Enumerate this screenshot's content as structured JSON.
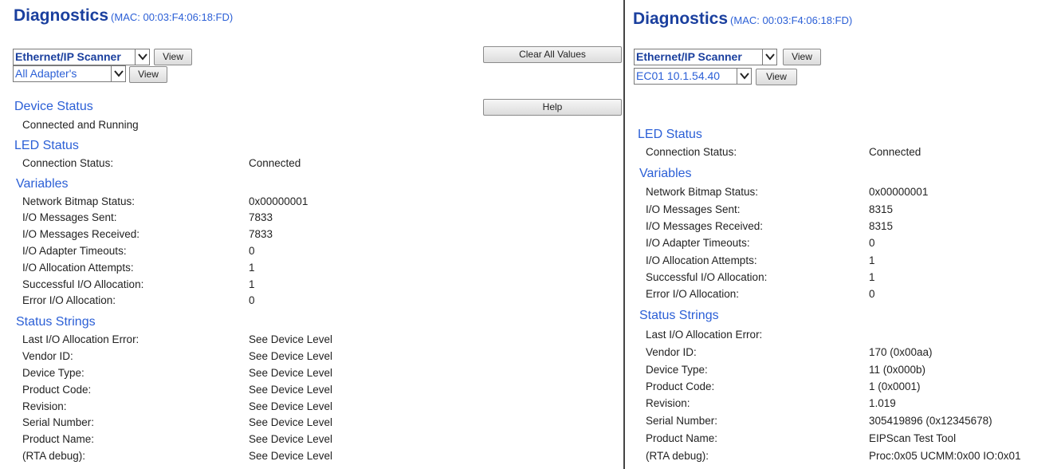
{
  "left": {
    "title": "Diagnostics",
    "mac": "(MAC: 00:03:F4:06:18:FD)",
    "scanner_select": "Ethernet/IP Scanner",
    "scanner_view_btn": "View",
    "adapter_select": "All Adapter's",
    "adapter_view_btn": "View",
    "clear_btn": "Clear All Values",
    "help_btn": "Help",
    "device_status_heading": "Device Status",
    "device_status_text": "Connected and Running",
    "led_heading": "LED Status",
    "led_rows": [
      {
        "label": "Connection Status:",
        "value": "Connected"
      }
    ],
    "variables_heading": "Variables",
    "variable_rows": [
      {
        "label": "Network Bitmap Status:",
        "value": "0x00000001"
      },
      {
        "label": "I/O Messages Sent:",
        "value": "7833"
      },
      {
        "label": "I/O Messages Received:",
        "value": "7833"
      },
      {
        "label": "I/O Adapter Timeouts:",
        "value": "0"
      },
      {
        "label": "I/O Allocation Attempts:",
        "value": "1"
      },
      {
        "label": "Successful I/O Allocation:",
        "value": "1"
      },
      {
        "label": "Error I/O Allocation:",
        "value": "0"
      }
    ],
    "status_heading": "Status Strings",
    "status_rows": [
      {
        "label": "Last I/O Allocation Error:",
        "value": "See Device Level"
      },
      {
        "label": "Vendor ID:",
        "value": "See Device Level"
      },
      {
        "label": "Device Type:",
        "value": "See Device Level"
      },
      {
        "label": "Product Code:",
        "value": "See Device Level"
      },
      {
        "label": "Revision:",
        "value": "See Device Level"
      },
      {
        "label": "Serial Number:",
        "value": "See Device Level"
      },
      {
        "label": "Product Name:",
        "value": "See Device Level"
      },
      {
        "label": "(RTA debug):",
        "value": "See Device Level"
      }
    ]
  },
  "right": {
    "title": "Diagnostics",
    "mac": "(MAC: 00:03:F4:06:18:FD)",
    "scanner_select": "Ethernet/IP Scanner",
    "scanner_view_btn": "View",
    "adapter_select": "EC01 10.1.54.40",
    "adapter_view_btn": "View",
    "led_heading": "LED Status",
    "led_rows": [
      {
        "label": "Connection Status:",
        "value": "Connected"
      }
    ],
    "variables_heading": "Variables",
    "variable_rows": [
      {
        "label": "Network Bitmap Status:",
        "value": "0x00000001"
      },
      {
        "label": "I/O Messages Sent:",
        "value": "8315"
      },
      {
        "label": "I/O Messages Received:",
        "value": "8315"
      },
      {
        "label": "I/O Adapter Timeouts:",
        "value": "0"
      },
      {
        "label": "I/O Allocation Attempts:",
        "value": "1"
      },
      {
        "label": "Successful I/O Allocation:",
        "value": "1"
      },
      {
        "label": "Error I/O Allocation:",
        "value": "0"
      }
    ],
    "status_heading": "Status Strings",
    "status_rows": [
      {
        "label": "Last I/O Allocation Error:",
        "value": ""
      },
      {
        "label": "Vendor ID:",
        "value": "170 (0x00aa)"
      },
      {
        "label": "Device Type:",
        "value": "11 (0x000b)"
      },
      {
        "label": "Product Code:",
        "value": "1 (0x0001)"
      },
      {
        "label": "Revision:",
        "value": "1.019"
      },
      {
        "label": "Serial Number:",
        "value": "305419896 (0x12345678)"
      },
      {
        "label": "Product Name:",
        "value": "EIPScan Test Tool"
      },
      {
        "label": "(RTA debug):",
        "value": "Proc:0x05 UCMM:0x00 IO:0x01"
      }
    ]
  }
}
